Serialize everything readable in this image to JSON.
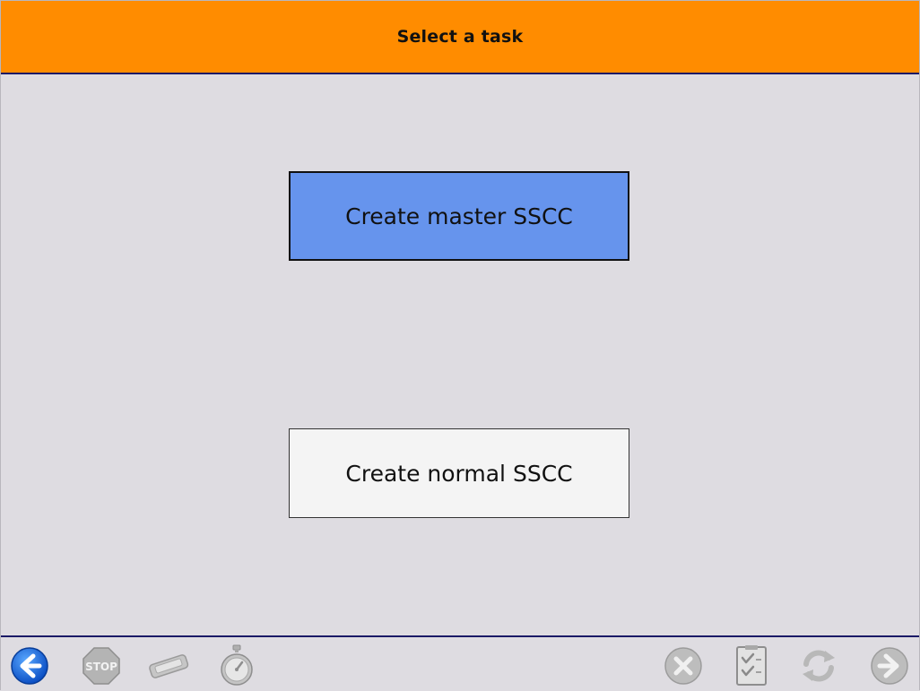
{
  "header": {
    "title": "Select a task"
  },
  "tasks": {
    "master_label": "Create master SSCC",
    "normal_label": "Create normal SSCC"
  },
  "toolbar": {
    "stop_label": "STOP",
    "icons": [
      "back-arrow-icon",
      "stop-sign-icon",
      "scanner-icon",
      "stopwatch-icon",
      "cancel-icon",
      "checklist-icon",
      "refresh-icon",
      "forward-arrow-icon"
    ]
  },
  "colors": {
    "header_bg": "#ff8c00",
    "selected_button": "#6694ed",
    "button_bg": "#f4f4f4",
    "page_bg": "#dedce1",
    "divider": "#1a1a66"
  }
}
